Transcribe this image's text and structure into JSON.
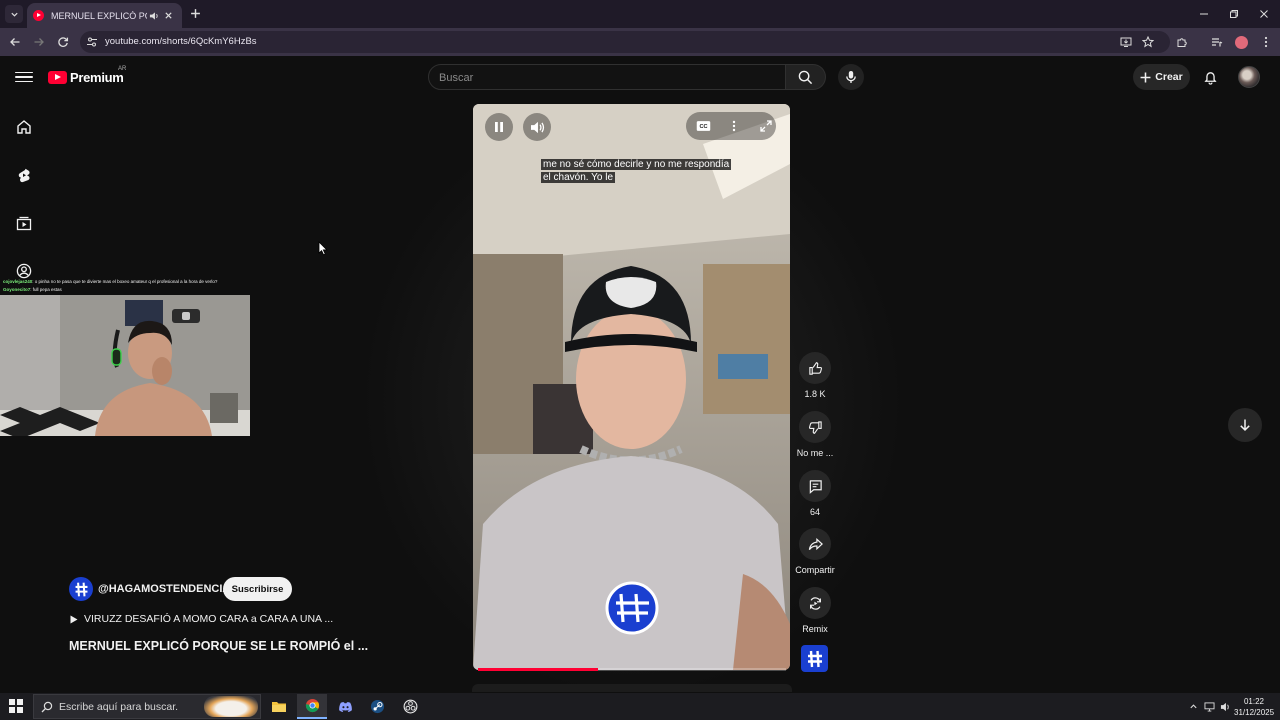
{
  "browser": {
    "tab_title": "MERNUEL EXPLICÓ PORQUE SE LE ROMPIÓ el ...",
    "url": "youtube.com/shorts/6QcKmY6HzBs"
  },
  "header": {
    "logo_text": "Premium",
    "country_code": "AR",
    "search_placeholder": "Buscar",
    "create_label": "Crear"
  },
  "chat_overlay": [
    {
      "user": "cojovlejas240",
      "message": ": o pinha no te pasa que te divierte mas el boxeo amateur q el profesional a la hora de verlo?"
    },
    {
      "user": "Goyonecito7",
      "message": ": full pepa estas"
    }
  ],
  "video": {
    "caption_line1": "me no sé cómo decirle y no me respondía",
    "caption_line2": "el chavón. Yo le",
    "progress": 0.39
  },
  "actions": {
    "like_count": "1.8 K",
    "dislike_label": "No me ...",
    "comments_count": "64",
    "share_label": "Compartir",
    "remix_label": "Remix"
  },
  "channel": {
    "handle": "@HAGAMOSTENDENCIA",
    "subscribe_label": "Suscribirse"
  },
  "playlist_title": "VIRUZZ DESAFIÓ A MOMO CARA a CARA A UNA ...",
  "video_title": "MERNUEL EXPLICÓ PORQUE SE LE ROMPIÓ el ...",
  "taskbar": {
    "search_placeholder": "Escribe aquí para buscar.",
    "time": "01:22",
    "date": "31/12/2025"
  }
}
